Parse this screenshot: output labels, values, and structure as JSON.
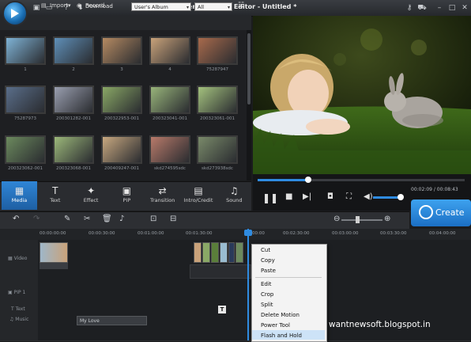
{
  "window": {
    "title": "Aimersoft Video Editor - Untitled *",
    "download_label": "Download",
    "icons": [
      "logo-icon",
      "save-icon",
      "folder-icon",
      "help-icon",
      "download-icon",
      "key-icon",
      "cart-icon",
      "minimize-icon",
      "maximize-icon",
      "close-icon"
    ]
  },
  "media_toolbar": {
    "import_label": "Import",
    "record_label": "Record",
    "album_select": "User's Album",
    "filter_select": "All"
  },
  "media_items": [
    {
      "label": "1",
      "color": "#7fb3d6"
    },
    {
      "label": "2",
      "color": "#5f8fb8"
    },
    {
      "label": "3",
      "color": "#b58a62"
    },
    {
      "label": "4",
      "color": "#c9a27a"
    },
    {
      "label": "75287947",
      "color": "#a86a4c"
    },
    {
      "label": "75287973",
      "color": "#5a6e8a"
    },
    {
      "label": "200301282-001",
      "color": "#9a9fb0"
    },
    {
      "label": "200322953-001",
      "color": "#8aa866"
    },
    {
      "label": "200323041-001",
      "color": "#98b47a"
    },
    {
      "label": "200323061-001",
      "color": "#a4c27e"
    },
    {
      "label": "200323062-001",
      "color": "#6c8a5e"
    },
    {
      "label": "200323068-001",
      "color": "#9cb87a"
    },
    {
      "label": "200409247-001",
      "color": "#c8a880"
    },
    {
      "label": "skd274595sdc",
      "color": "#b87a6a"
    },
    {
      "label": "skd273938sdc",
      "color": "#7a8a6a"
    }
  ],
  "tabs": [
    {
      "label": "Media",
      "icon": "media-icon",
      "active": true
    },
    {
      "label": "Text",
      "icon": "text-icon"
    },
    {
      "label": "Effect",
      "icon": "effect-icon"
    },
    {
      "label": "PIP",
      "icon": "pip-icon"
    },
    {
      "label": "Transition",
      "icon": "transition-icon"
    },
    {
      "label": "Intro/Credit",
      "icon": "intro-credit-icon"
    },
    {
      "label": "Sound",
      "icon": "sound-icon"
    }
  ],
  "player": {
    "time": "00:02:09 / 00:08:43",
    "progress_fraction": 0.24,
    "volume_fraction": 0.85
  },
  "create_label": "Create",
  "timeline": {
    "ruler": [
      "00:00:00:00",
      "00:00:30:00",
      "00:01:00:00",
      "00:01:30:00",
      "00:02:00:00",
      "00:02:30:00",
      "00:03:00:00",
      "00:03:30:00",
      "00:04:00:00"
    ],
    "ruler_partial": "00:00",
    "tracks": [
      {
        "label": "Video"
      },
      {
        "label": "PIP 1"
      },
      {
        "label": "Text"
      },
      {
        "label": "Music"
      }
    ],
    "music_clip": "My Love",
    "text_marker": "T"
  },
  "context_menu": {
    "items": [
      "Cut",
      "Copy",
      "Paste",
      "Edit",
      "Crop",
      "Split",
      "Delete Motion",
      "Power Tool",
      "Flash and Hold"
    ],
    "highlighted": "Flash and Hold"
  },
  "watermark": "wantnewsoft.blogspot.in"
}
